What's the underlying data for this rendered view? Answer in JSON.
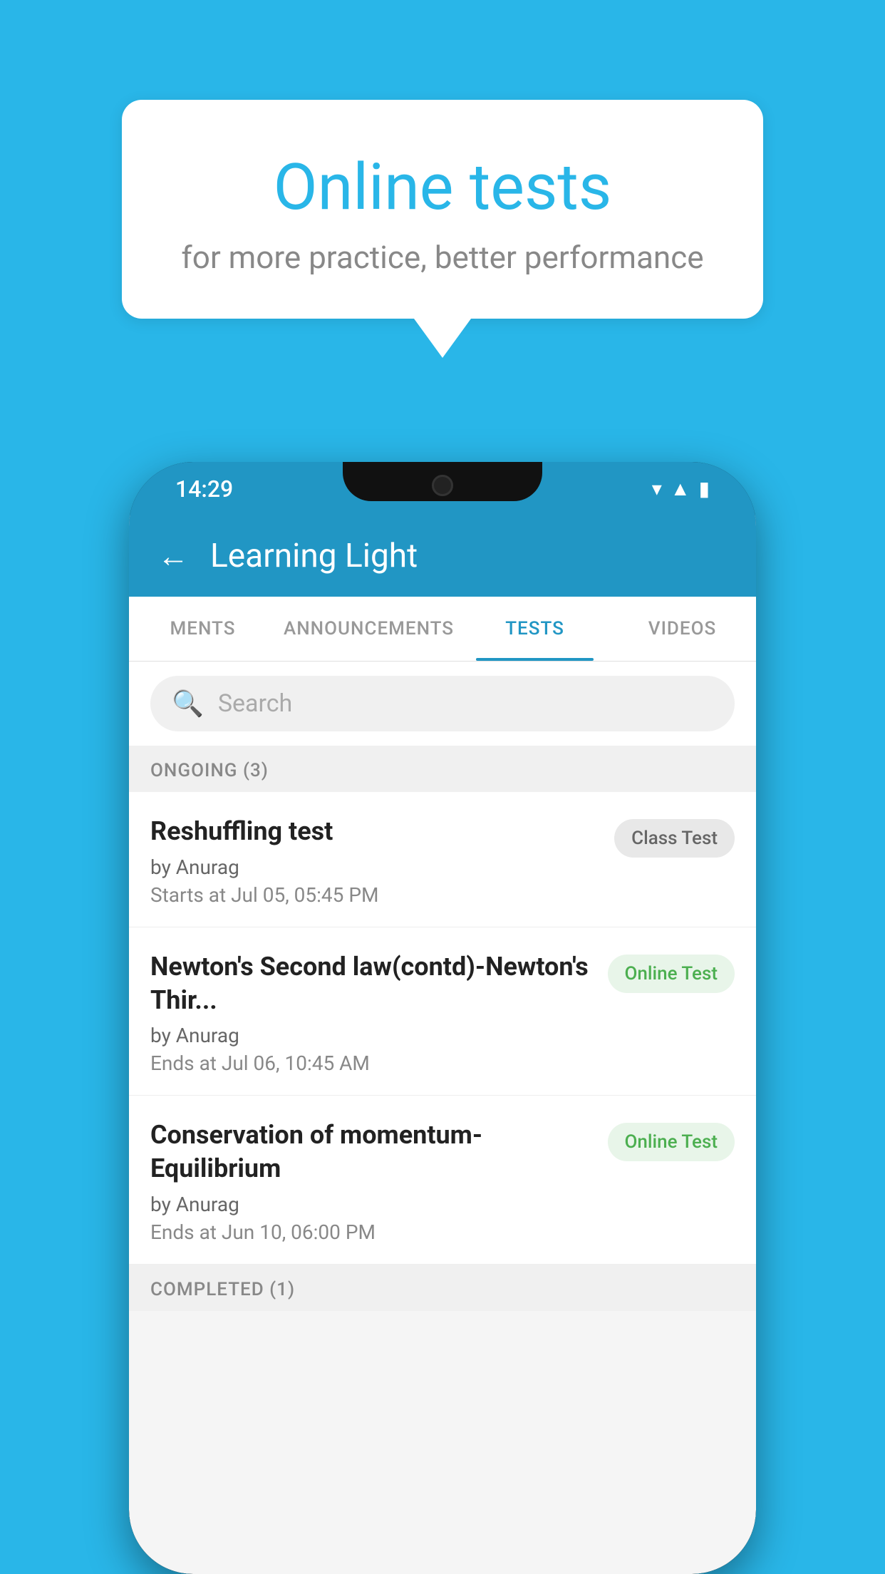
{
  "background": {
    "color": "#29b6e8"
  },
  "speech_bubble": {
    "title": "Online tests",
    "subtitle": "for more practice, better performance"
  },
  "phone": {
    "status_bar": {
      "time": "14:29",
      "icons": [
        "wifi",
        "signal",
        "battery"
      ]
    },
    "header": {
      "back_label": "←",
      "title": "Learning Light"
    },
    "tabs": [
      {
        "label": "MENTS",
        "active": false
      },
      {
        "label": "ANNOUNCEMENTS",
        "active": false
      },
      {
        "label": "TESTS",
        "active": true
      },
      {
        "label": "VIDEOS",
        "active": false
      }
    ],
    "search": {
      "placeholder": "Search"
    },
    "ongoing_section": {
      "title": "ONGOING (3)",
      "items": [
        {
          "name": "Reshuffling test",
          "author": "by Anurag",
          "time_label": "Starts at",
          "time": "Jul 05, 05:45 PM",
          "badge": "Class Test",
          "badge_type": "class"
        },
        {
          "name": "Newton's Second law(contd)-Newton's Thir...",
          "author": "by Anurag",
          "time_label": "Ends at",
          "time": "Jul 06, 10:45 AM",
          "badge": "Online Test",
          "badge_type": "online"
        },
        {
          "name": "Conservation of momentum-Equilibrium",
          "author": "by Anurag",
          "time_label": "Ends at",
          "time": "Jun 10, 06:00 PM",
          "badge": "Online Test",
          "badge_type": "online"
        }
      ]
    },
    "completed_section": {
      "title": "COMPLETED (1)"
    }
  }
}
